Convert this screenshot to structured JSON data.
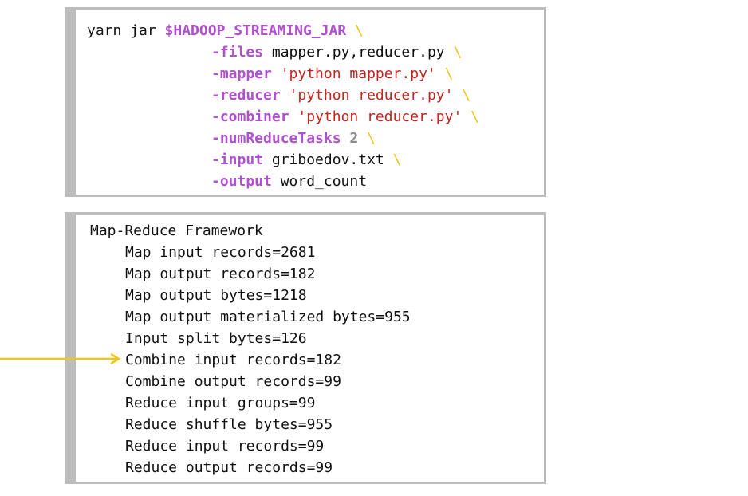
{
  "command": {
    "prefix": "yarn jar ",
    "jar_var": "$HADOOP_STREAMING_JAR",
    "continuation": "\\",
    "args": [
      {
        "flag": "-files",
        "value": "mapper.py,reducer.py",
        "value_type": "plain"
      },
      {
        "flag": "-mapper",
        "value": "'python mapper.py'",
        "value_type": "string"
      },
      {
        "flag": "-reducer",
        "value": "'python reducer.py'",
        "value_type": "string"
      },
      {
        "flag": "-combiner",
        "value": "'python reducer.py'",
        "value_type": "string"
      },
      {
        "flag": "-numReduceTasks",
        "value": "2",
        "value_type": "number"
      },
      {
        "flag": "-input",
        "value": "griboedov.txt",
        "value_type": "plain"
      },
      {
        "flag": "-output",
        "value": "word_count",
        "value_type": "plain"
      }
    ]
  },
  "counters": {
    "title": "Map-Reduce Framework",
    "items": [
      "Map input records=2681",
      "Map output records=182",
      "Map output bytes=1218",
      "Map output materialized bytes=955",
      "Input split bytes=126",
      "Combine input records=182",
      "Combine output records=99",
      "Reduce input groups=99",
      "Reduce shuffle bytes=955",
      "Reduce input records=99",
      "Reduce output records=99"
    ],
    "highlighted_item": "Combine input records=182"
  },
  "colors": {
    "flag": "#b04fd0",
    "string": "#c4251e",
    "number": "#8a8a8a",
    "continuation": "#f0c419",
    "arrow": "#f0c419",
    "panel_border": "#bdbdbd"
  }
}
